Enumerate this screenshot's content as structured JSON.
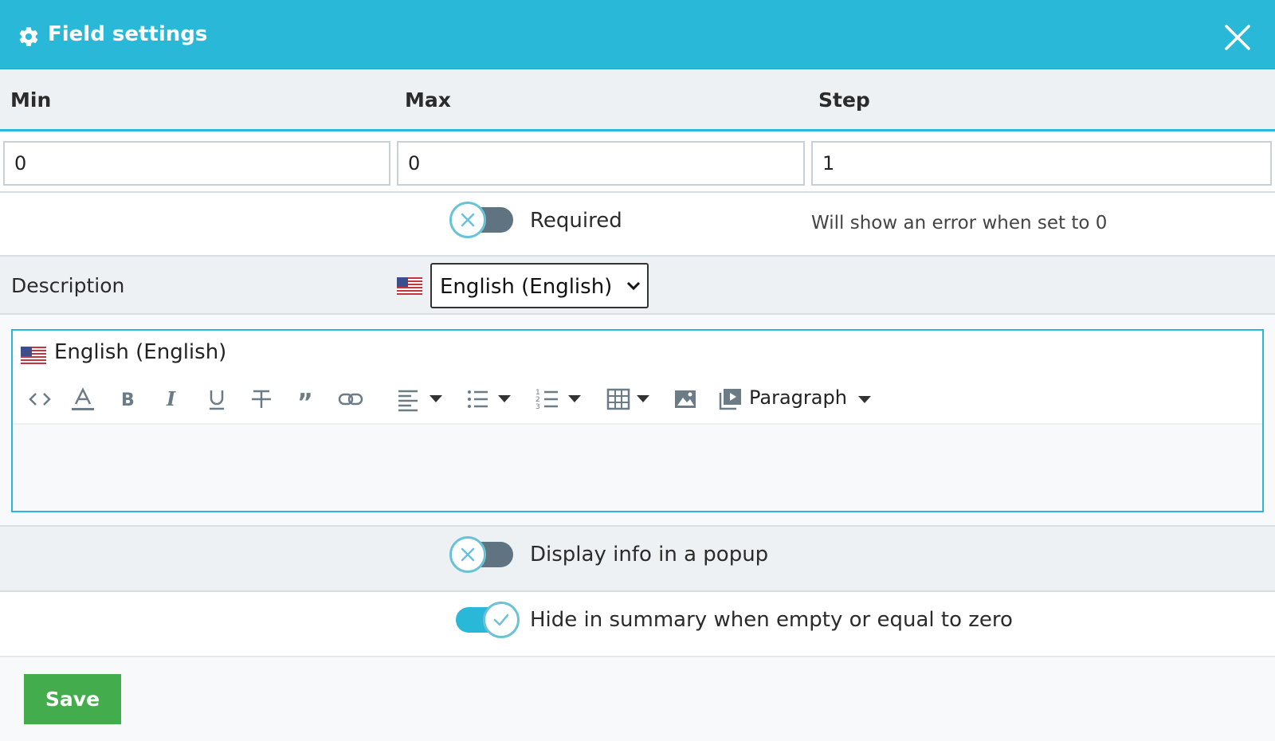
{
  "header": {
    "title": "Field settings",
    "icon": "gear-icon",
    "close_icon": "close-icon",
    "background": "#29b8d8"
  },
  "columns": {
    "min_label": "Min",
    "max_label": "Max",
    "step_label": "Step"
  },
  "inputs": {
    "min_value": "0",
    "max_value": "0",
    "step_value": "1"
  },
  "required": {
    "label": "Required",
    "state": "off",
    "hint": "Will show an error when set to 0"
  },
  "description": {
    "label": "Description",
    "language_selected": "English (English)",
    "flag_icon": "us-flag-icon"
  },
  "editor": {
    "language_label": "English (English)",
    "toolbar": [
      "source-code-icon",
      "font-color-icon",
      "bold-icon",
      "italic-icon",
      "underline-icon",
      "strikethrough-icon",
      "blockquote-icon",
      "link-icon",
      "align-left-icon",
      "bulleted-list-icon",
      "numbered-list-icon",
      "table-icon",
      "image-icon",
      "media-icon"
    ],
    "paragraph_label": "Paragraph",
    "content": ""
  },
  "popup": {
    "label": "Display info in a popup",
    "state": "off"
  },
  "hide_summary": {
    "label": "Hide in summary when empty or equal to zero",
    "state": "on"
  },
  "footer": {
    "save_label": "Save",
    "save_color": "#43ac4c"
  }
}
